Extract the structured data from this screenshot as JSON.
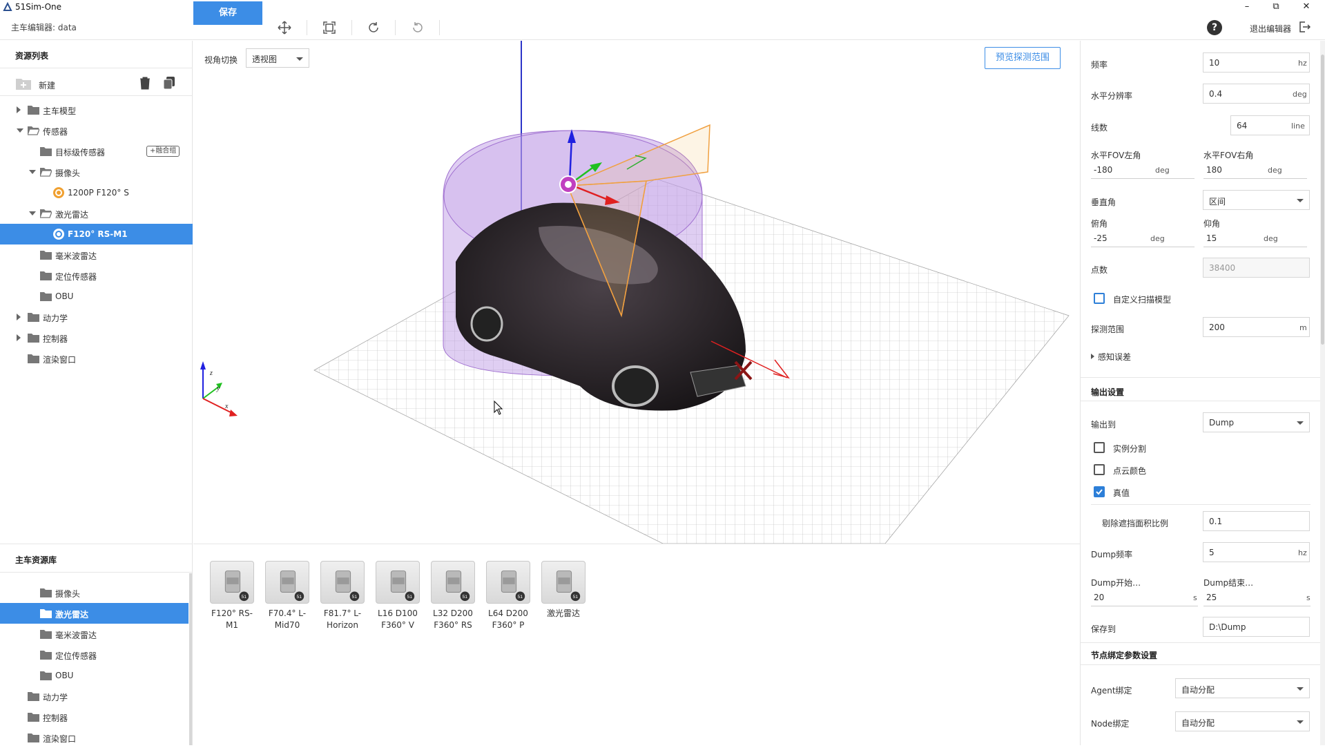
{
  "app": {
    "title": "51Sim-One",
    "editor_title": "主车编辑器: data",
    "save_label": "保存",
    "exit_label": "退出编辑器"
  },
  "window_buttons": {
    "minimize": "–",
    "restore": "⧉",
    "close": "✕"
  },
  "left": {
    "header": "资源列表",
    "new_label": "新建",
    "tree": [
      {
        "label": "主车模型",
        "level": 1,
        "expand": "right",
        "type": "folder"
      },
      {
        "label": "传感器",
        "level": 1,
        "expand": "down",
        "type": "folder-open"
      },
      {
        "label": "目标级传感器",
        "level": 2,
        "expand": "",
        "type": "folder",
        "badge": "+融合组"
      },
      {
        "label": "摄像头",
        "level": 2,
        "expand": "down",
        "type": "folder-open"
      },
      {
        "label": "1200P F120° S",
        "level": 3,
        "expand": "",
        "type": "camera"
      },
      {
        "label": "激光雷达",
        "level": 2,
        "expand": "down",
        "type": "folder-open"
      },
      {
        "label": "F120° RS-M1",
        "level": 3,
        "expand": "",
        "type": "lidar",
        "selected": true
      },
      {
        "label": "毫米波雷达",
        "level": 2,
        "expand": "",
        "type": "folder"
      },
      {
        "label": "定位传感器",
        "level": 2,
        "expand": "",
        "type": "folder"
      },
      {
        "label": "OBU",
        "level": 2,
        "expand": "",
        "type": "folder"
      },
      {
        "label": "动力学",
        "level": 1,
        "expand": "right",
        "type": "folder"
      },
      {
        "label": "控制器",
        "level": 1,
        "expand": "right",
        "type": "folder"
      },
      {
        "label": "渲染窗口",
        "level": 1,
        "expand": "",
        "type": "folder"
      }
    ],
    "library_header": "主车资源库",
    "library_tree": [
      {
        "label": "摄像头",
        "level": 2,
        "selected": false
      },
      {
        "label": "激光雷达",
        "level": 2,
        "selected": true
      },
      {
        "label": "毫米波雷达",
        "level": 2,
        "selected": false
      },
      {
        "label": "定位传感器",
        "level": 2,
        "selected": false
      },
      {
        "label": "OBU",
        "level": 2,
        "selected": false
      },
      {
        "label": "动力学",
        "level": 1,
        "selected": false
      },
      {
        "label": "控制器",
        "level": 1,
        "selected": false
      },
      {
        "label": "渲染窗口",
        "level": 1,
        "selected": false
      }
    ]
  },
  "viewport": {
    "view_label": "视角切换",
    "view_value": "透视图",
    "preview_label": "预览探测范围",
    "axis_labels": {
      "z": "z",
      "y": "y",
      "x": "x"
    }
  },
  "library_items": [
    {
      "line1": "F120° RS-",
      "line2": "M1"
    },
    {
      "line1": "F70.4° L-",
      "line2": "Mid70"
    },
    {
      "line1": "F81.7° L-",
      "line2": "Horizon"
    },
    {
      "line1": "L16 D100",
      "line2": "F360° V"
    },
    {
      "line1": "L32 D200",
      "line2": "F360° RS"
    },
    {
      "line1": "L64 D200",
      "line2": "F360° P"
    },
    {
      "line1": "激光雷达",
      "line2": ""
    }
  ],
  "props": {
    "freq_label": "频率",
    "freq_value": "10",
    "freq_unit": "hz",
    "hres_label": "水平分辨率",
    "hres_value": "0.4",
    "hres_unit": "deg",
    "lines_label": "线数",
    "lines_value": "64",
    "lines_unit": "line",
    "fov_left_label": "水平FOV左角",
    "fov_left_value": "-180",
    "fov_left_unit": "deg",
    "fov_right_label": "水平FOV右角",
    "fov_right_value": "180",
    "fov_right_unit": "deg",
    "vert_label": "垂直角",
    "vert_value": "区间",
    "down_label": "俯角",
    "down_value": "-25",
    "down_unit": "deg",
    "up_label": "仰角",
    "up_value": "15",
    "up_unit": "deg",
    "points_label": "点数",
    "points_value": "38400",
    "custom_scan_label": "自定义扫描模型",
    "range_label": "探测范围",
    "range_value": "200",
    "range_unit": "m",
    "error_label": "感知误差",
    "output_header": "输出设置",
    "output_to_label": "输出到",
    "output_to_value": "Dump",
    "instance_label": "实例分割",
    "pc_color_label": "点云颜色",
    "truth_label": "真值",
    "occlusion_label": "剔除遮挡面积比例",
    "occlusion_value": "0.1",
    "dump_freq_label": "Dump频率",
    "dump_freq_value": "5",
    "dump_freq_unit": "hz",
    "dump_start_label": "Dump开始…",
    "dump_start_value": "20",
    "dump_start_unit": "s",
    "dump_end_label": "Dump结束…",
    "dump_end_value": "25",
    "dump_end_unit": "s",
    "save_to_label": "保存到",
    "save_to_value": "D:\\Dump",
    "node_header": "节点绑定参数设置",
    "agent_label": "Agent绑定",
    "agent_value": "自动分配",
    "node_label": "Node绑定",
    "node_value": "自动分配"
  },
  "colors": {
    "accent": "#3c8de6",
    "sensor_volume": "#b38be0",
    "fov_frustum": "#f0a040"
  }
}
